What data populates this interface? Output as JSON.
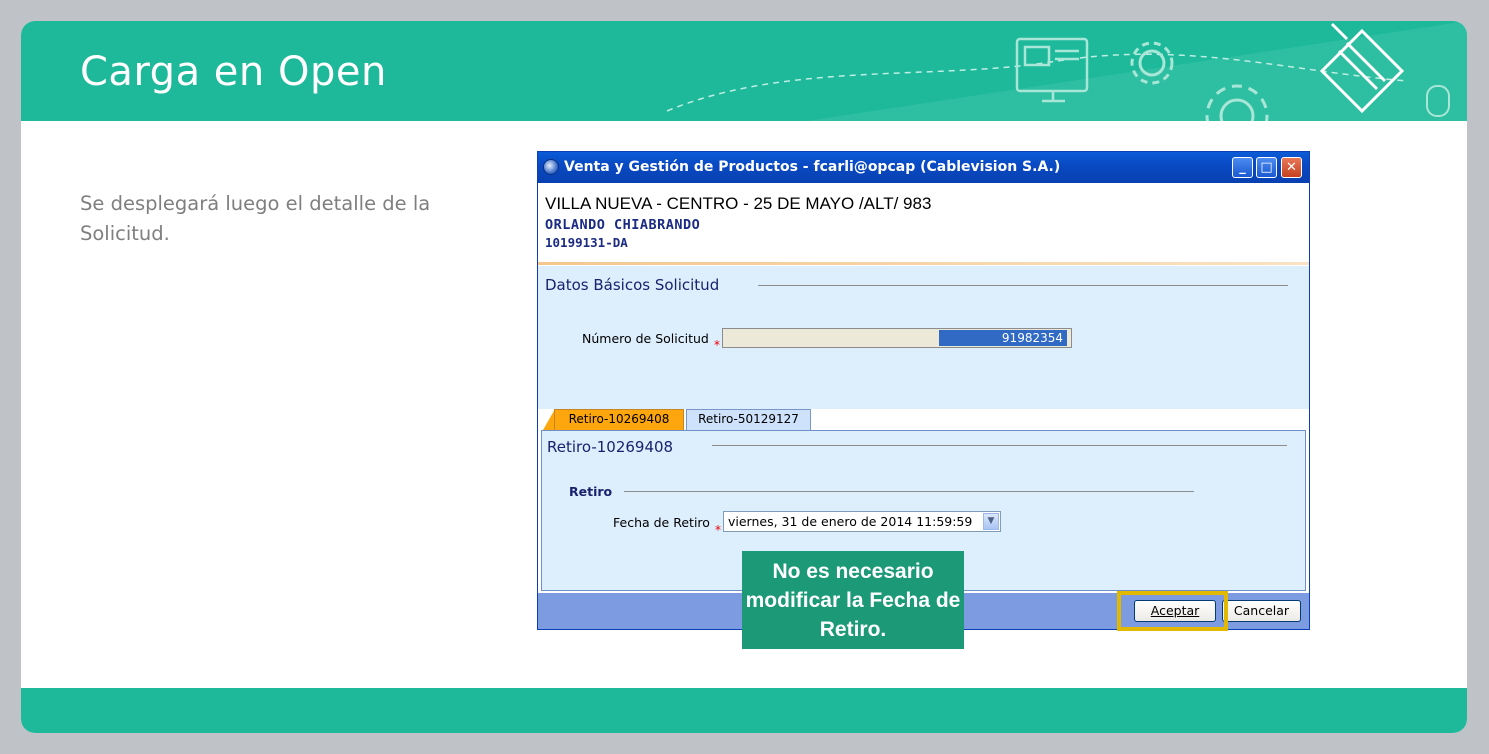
{
  "slide": {
    "title": "Carga en Open",
    "description": "Se desplegará luego el detalle de la Solicitud.",
    "accent_color": "#1db99a",
    "highlight_color": "#e3b800",
    "callout_color": "#1c9a78"
  },
  "window": {
    "title": "Venta y Gestión de Productos - fcarli@opcap (Cablevision S.A.)",
    "controls": {
      "minimize": "_",
      "maximize": "□",
      "close": "✕"
    },
    "address": "VILLA NUEVA - CENTRO - 25 DE MAYO /ALT/ 983",
    "customer": "ORLANDO  CHIABRANDO",
    "account": "10199131-DA",
    "basic_section_title": "Datos Básicos Solicitud",
    "numero_label": "Número de Solicitud",
    "numero_value": "91982354",
    "required_mark": "*",
    "tabs": [
      {
        "label": "Retiro-10269408",
        "active": true
      },
      {
        "label": "Retiro-50129127",
        "active": false
      }
    ],
    "tab_panel_title": "Retiro-10269408",
    "retiro_group": "Retiro",
    "fecha_label": "Fecha de Retiro",
    "fecha_value": "viernes, 31 de enero de 2014 11:59:59",
    "accept_label": "Aceptar",
    "cancel_label": "Cancelar"
  },
  "callout": {
    "text": "No es necesario modificar la Fecha de Retiro."
  }
}
